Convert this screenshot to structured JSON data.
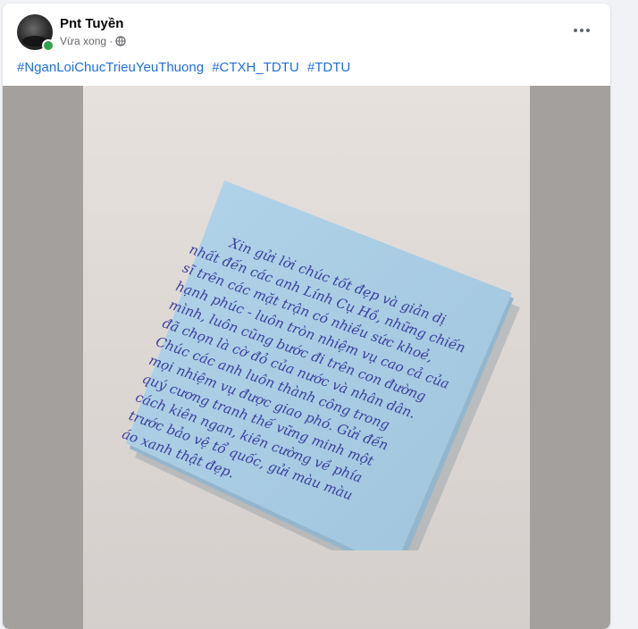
{
  "post": {
    "author": "Pnt Tuyền",
    "timestamp": "Vừa xong",
    "separator": "·",
    "privacy_icon": "globe-icon",
    "more_icon": "more-options-icon",
    "hashtags": [
      "#NganLoiChucTrieuYeuThuong",
      "#CTXH_TDTU",
      "#TDTU"
    ]
  },
  "photo": {
    "handwritten_lines": [
      "Xin gửi lời chúc tốt đẹp và giản dị",
      "nhất đến các anh Lính Cụ Hồ, những chiến",
      "sĩ trên các mặt trận có nhiều sức khoẻ,",
      "hạnh phúc - luôn tròn nhiệm vụ cao cả của",
      "mình, luôn cũng bước đi trên con đường",
      "đã chọn là cờ đỏ của nước và nhân dân.",
      "Chúc các anh luôn thành công trong",
      "mọi nhiệm vụ được giao phó. Gửi đến",
      "quý cương tranh thế vững minh một",
      "cách kiên ngan, kiên cường về phía",
      "trước bảo vệ tổ quốc, gửi màu màu",
      "áo xanh thật đẹp."
    ]
  },
  "colors": {
    "link": "#216fdb",
    "note": "#a9cde4",
    "ink": "#3b3f9c"
  }
}
